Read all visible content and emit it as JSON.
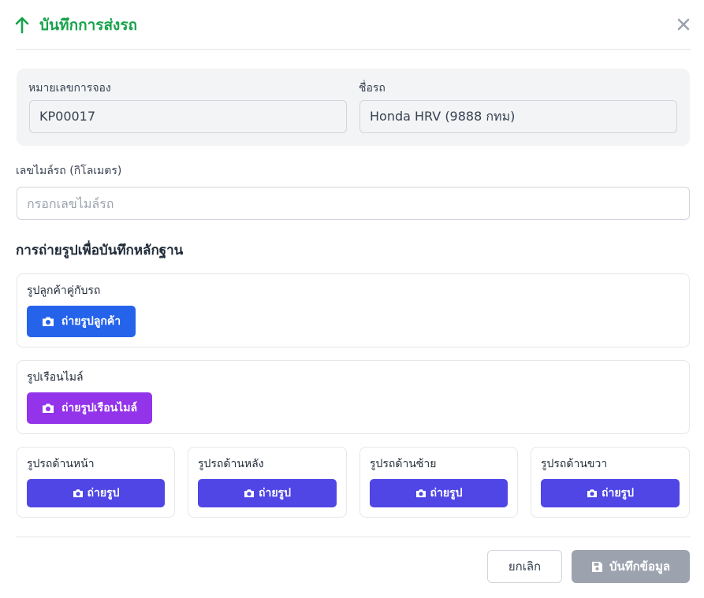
{
  "header": {
    "title": "บันทึกการส่งรถ",
    "icon": "arrow-up-icon",
    "close_icon": "close-icon",
    "accent_color": "#16a34a"
  },
  "booking": {
    "booking_label": "หมายเลขการจอง",
    "booking_value": "KP00017",
    "car_label": "ชื่อรถ",
    "car_value": "Honda HRV (9888 กทม)"
  },
  "mileage": {
    "label": "เลขไมล์รถ (กิโลเมตร)",
    "value": "",
    "placeholder": "กรอกเลขไมล์รถ"
  },
  "photos": {
    "section_title": "การถ่ายรูปเพื่อบันทึกหลักฐาน",
    "customer": {
      "label": "รูปลูกค้าคู่กับรถ",
      "button": "ถ่ายรูปลูกค้า",
      "color": "#2563eb"
    },
    "odometer": {
      "label": "รูปเรือนไมล์",
      "button": "ถ่ายรูปเรือนไมล์",
      "color": "#9333ea"
    },
    "sides": [
      {
        "label": "รูปรถด้านหน้า",
        "button": "ถ่ายรูป"
      },
      {
        "label": "รูปรถด้านหลัง",
        "button": "ถ่ายรูป"
      },
      {
        "label": "รูปรถด้านซ้าย",
        "button": "ถ่ายรูป"
      },
      {
        "label": "รูปรถด้านขวา",
        "button": "ถ่ายรูป"
      }
    ],
    "side_button_color": "#4f46e5",
    "button_icon": "camera-icon"
  },
  "footer": {
    "cancel_label": "ยกเลิก",
    "save_label": "บันทึกข้อมูล",
    "save_icon": "save-icon",
    "save_color": "#9ca3af"
  }
}
